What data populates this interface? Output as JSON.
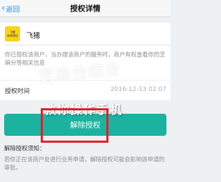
{
  "nav": {
    "back_label": "返回",
    "title": "授权详情"
  },
  "merchant": {
    "logo_text_1": "飞猪",
    "logo_text_2": "未来酒店",
    "name": "飞猪",
    "description": "你已授权该商户，当办理该商户的服务时，商户有权查看你的芝麻分等相关信息"
  },
  "auth_time": {
    "label": "授权时间",
    "value": "2016-12-13 02:07"
  },
  "watermark": {
    "text": "芝麻分综合",
    "overlay_text": "教你操作手机"
  },
  "actions": {
    "revoke_label": "解除授权"
  },
  "notes": {
    "title": "解除授权须知：",
    "text": "若你正在该商户处进行业务申请，解除授权可能会影响该申请的审批。"
  },
  "colors": {
    "accent_blue": "#1e8fe6",
    "button_teal": "#1cb2a0",
    "highlight_red": "#e41c2a",
    "logo_yellow": "#f9d21b"
  }
}
